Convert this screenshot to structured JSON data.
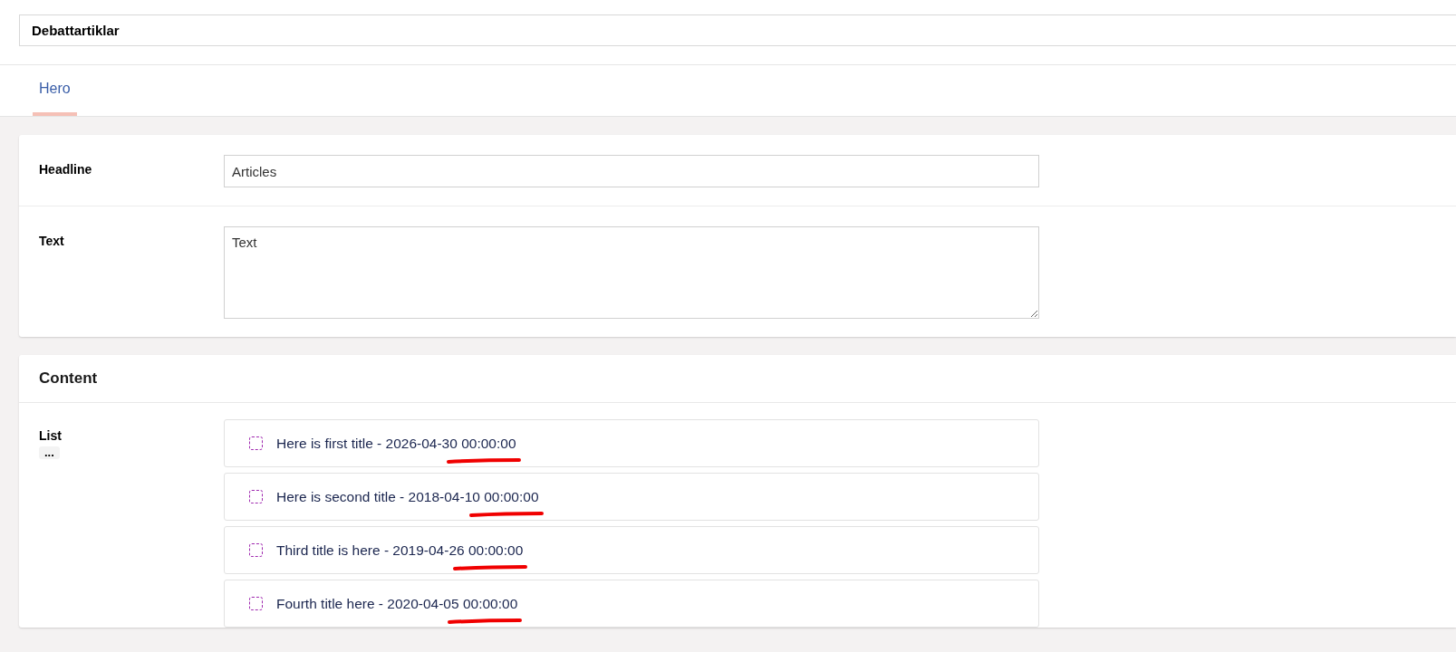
{
  "title_field": {
    "value": "Debattartiklar"
  },
  "tabs": [
    {
      "label": "Hero",
      "selected": true
    }
  ],
  "hero": {
    "fields": [
      {
        "kind": "input",
        "label": "Headline",
        "value": "Articles"
      },
      {
        "kind": "textarea",
        "label": "Text",
        "value": "Text"
      }
    ]
  },
  "content": {
    "heading": "Content",
    "list": {
      "label": "List",
      "more": "...",
      "items": [
        {
          "text": "Here is first title - 2026-04-30 00:00:00",
          "checked": false,
          "underlined": true
        },
        {
          "text": "Here is second title - 2018-04-10 00:00:00",
          "checked": false,
          "underlined": true
        },
        {
          "text": "Third title is here - 2019-04-26 00:00:00",
          "checked": false,
          "underlined": true
        },
        {
          "text": "Fourth title here - 2020-04-05 00:00:00",
          "checked": false,
          "underlined": true
        }
      ]
    }
  }
}
